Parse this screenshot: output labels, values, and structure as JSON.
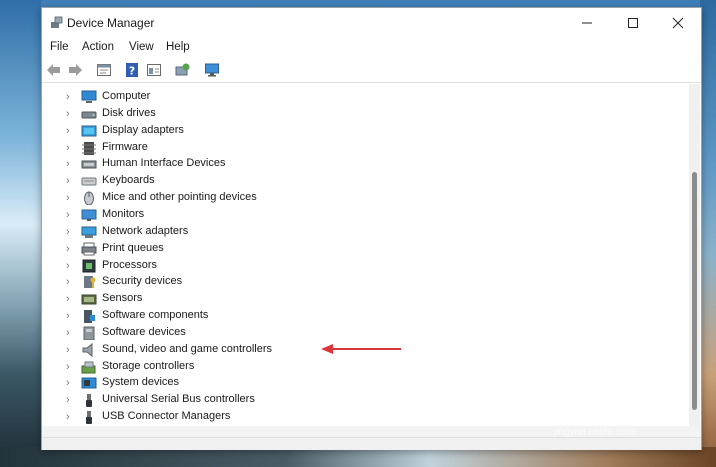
{
  "window": {
    "title": "Device Manager"
  },
  "menu": [
    "File",
    "Action",
    "View",
    "Help"
  ],
  "toolbar_icons": [
    "back-arrow-icon",
    "forward-arrow-icon",
    "properties-icon",
    "help-icon",
    "view-icon",
    "scan-hardware-icon",
    "monitor-icon"
  ],
  "devices": [
    {
      "label": "Computer",
      "icon": "computer-icon"
    },
    {
      "label": "Disk drives",
      "icon": "disk-drive-icon"
    },
    {
      "label": "Display adapters",
      "icon": "display-adapter-icon"
    },
    {
      "label": "Firmware",
      "icon": "firmware-icon"
    },
    {
      "label": "Human Interface Devices",
      "icon": "hid-icon"
    },
    {
      "label": "Keyboards",
      "icon": "keyboard-icon"
    },
    {
      "label": "Mice and other pointing devices",
      "icon": "mouse-icon"
    },
    {
      "label": "Monitors",
      "icon": "monitor-icon"
    },
    {
      "label": "Network adapters",
      "icon": "network-adapter-icon"
    },
    {
      "label": "Print queues",
      "icon": "printer-icon"
    },
    {
      "label": "Processors",
      "icon": "processor-icon"
    },
    {
      "label": "Security devices",
      "icon": "security-device-icon"
    },
    {
      "label": "Sensors",
      "icon": "sensor-icon"
    },
    {
      "label": "Software components",
      "icon": "software-component-icon"
    },
    {
      "label": "Software devices",
      "icon": "software-device-icon"
    },
    {
      "label": "Sound, video and game controllers",
      "icon": "speaker-icon"
    },
    {
      "label": "Storage controllers",
      "icon": "storage-controller-icon"
    },
    {
      "label": "System devices",
      "icon": "system-device-icon"
    },
    {
      "label": "Universal Serial Bus controllers",
      "icon": "usb-icon"
    },
    {
      "label": "USB Connector Managers",
      "icon": "usb-connector-icon"
    }
  ],
  "annotation": {
    "points_to": "Sound, video and game controllers",
    "color": "#d9373a"
  },
  "watermark": {
    "main": "Bai 经验",
    "sub": "jingyan.baidu.com"
  }
}
